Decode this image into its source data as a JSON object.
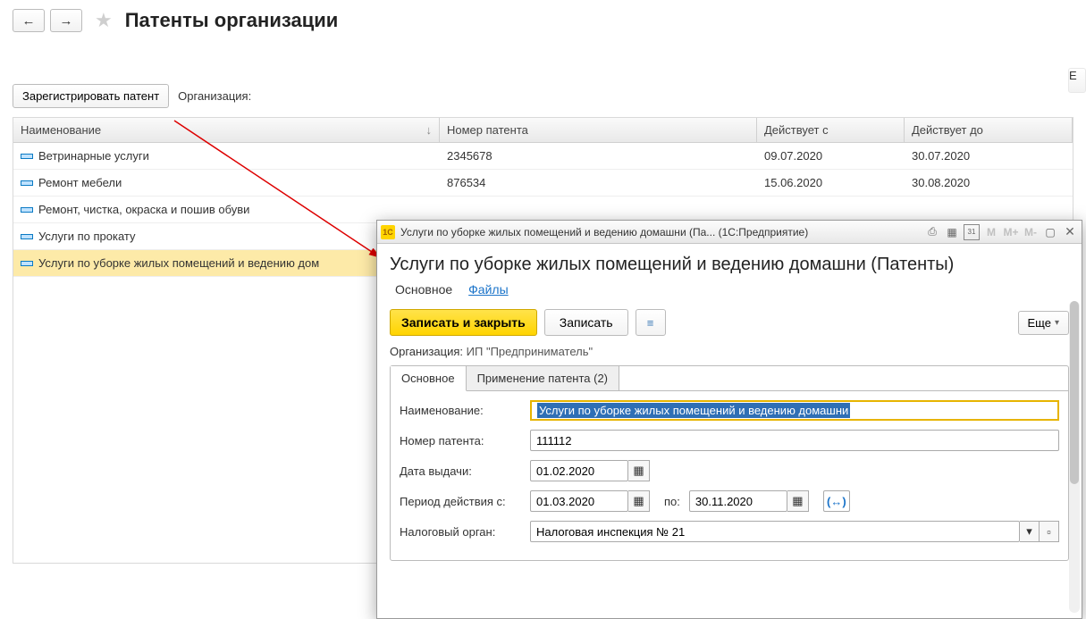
{
  "nav": {
    "back": "←",
    "fwd": "→"
  },
  "page_title": "Патенты организации",
  "toolbar": {
    "register_btn": "Зарегистрировать патент",
    "org_label": "Организация:"
  },
  "side_button": "Е",
  "grid": {
    "headers": {
      "name": "Наименование",
      "num": "Номер патента",
      "from": "Действует с",
      "to": "Действует до"
    },
    "sort_arrow": "↓",
    "rows": [
      {
        "name": "Ветринарные услуги",
        "num": "2345678",
        "from": "09.07.2020",
        "to": "30.07.2020"
      },
      {
        "name": "Ремонт мебели",
        "num": "876534",
        "from": "15.06.2020",
        "to": "30.08.2020"
      },
      {
        "name": "Ремонт, чистка, окраска и пошив обуви",
        "num": "",
        "from": "",
        "to": ""
      },
      {
        "name": "Услуги по прокату",
        "num": "",
        "from": "",
        "to": ""
      },
      {
        "name": "Услуги по уборке жилых помещений и ведению дом",
        "num": "",
        "from": "",
        "to": ""
      }
    ]
  },
  "dialog": {
    "logo": "1C",
    "title_compact": "Услуги по уборке жилых помещений и ведению домашни (Па...  (1С:Предприятие)",
    "title_icons": {
      "print": "⎙",
      "calc": "▦",
      "cal": "31",
      "m": "M",
      "mp": "M+",
      "mm": "M-",
      "min": "▢",
      "close": "✕"
    },
    "heading": "Услуги по уборке жилых помещений и ведению домашни (Патенты)",
    "inner_tabs": {
      "main": "Основное",
      "files": "Файлы"
    },
    "buttons": {
      "save_close": "Записать и закрыть",
      "save": "Записать",
      "more": "Еще",
      "more_arrow": "▾",
      "list_icon": "≡"
    },
    "org_label": "Организация:",
    "org_value": "ИП \"Предприниматель\"",
    "tabs": {
      "main": "Основное",
      "usage": "Применение патента (2)"
    },
    "form": {
      "name_label": "Наименование:",
      "name_value": "Услуги по уборке жилых помещений и ведению домашни",
      "num_label": "Номер патента:",
      "num_value": "111112",
      "date_label": "Дата выдачи:",
      "date_value": "01.02.2020",
      "period_label": "Период действия с:",
      "period_from": "01.03.2020",
      "period_sep": "по:",
      "period_to": "30.11.2020",
      "tax_label": "Налоговый орган:",
      "tax_value": "Налоговая инспекция № 21",
      "cal_icon": "▦",
      "dd_arrow": "▾",
      "open_icon": "▫",
      "bracket": "(↔)"
    }
  }
}
